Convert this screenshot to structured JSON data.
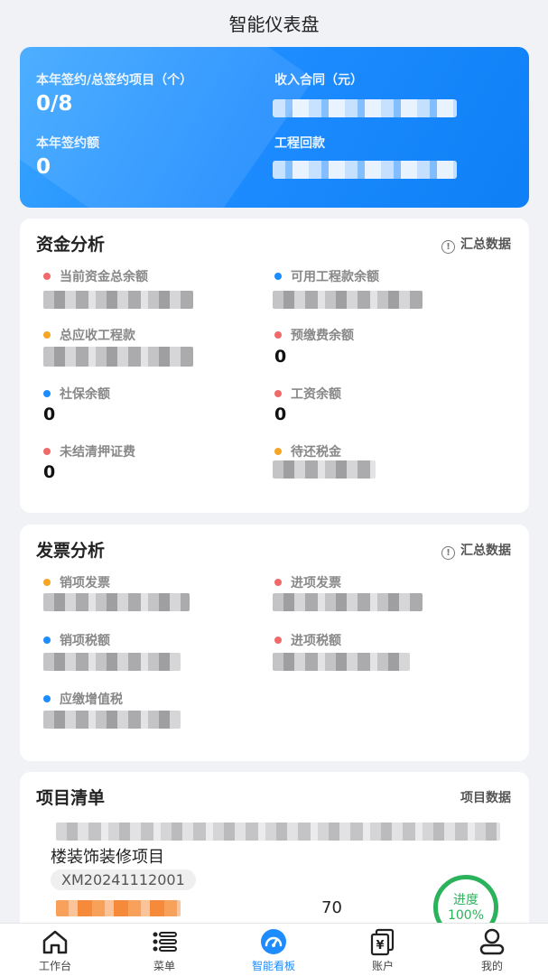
{
  "header": {
    "title": "智能仪表盘"
  },
  "summary": {
    "signed_projects_label": "本年签约/总签约项目（个）",
    "signed_projects_value": "0/8",
    "income_contract_label": "收入合同（元）",
    "signed_amount_label": "本年签约额",
    "signed_amount_value": "0",
    "project_return_label": "工程回款"
  },
  "funds": {
    "title": "资金分析",
    "link": "汇总数据",
    "items": [
      {
        "label": "当前资金总余额",
        "dot_color": "#f06a6a",
        "value": ""
      },
      {
        "label": "可用工程款余额",
        "dot_color": "#1d8cff",
        "value": ""
      },
      {
        "label": "总应收工程款",
        "dot_color": "#f5a623",
        "value": ""
      },
      {
        "label": "预缴费余额",
        "dot_color": "#f06a6a",
        "value": "0"
      },
      {
        "label": "社保余额",
        "dot_color": "#1d8cff",
        "value": "0"
      },
      {
        "label": "工资余额",
        "dot_color": "#f06a6a",
        "value": "0"
      },
      {
        "label": "未结清押证费",
        "dot_color": "#f06a6a",
        "value": "0"
      },
      {
        "label": "待还税金",
        "dot_color": "#f5a623",
        "value": ""
      }
    ]
  },
  "invoice": {
    "title": "发票分析",
    "link": "汇总数据",
    "items": [
      {
        "label": "销项发票",
        "dot_color": "#f5a623"
      },
      {
        "label": "进项发票",
        "dot_color": "#f06a6a"
      },
      {
        "label": "销项税额",
        "dot_color": "#1d8cff"
      },
      {
        "label": "进项税额",
        "dot_color": "#f06a6a"
      },
      {
        "label": "应缴增值税",
        "dot_color": "#1d8cff"
      }
    ]
  },
  "projects": {
    "title": "项目清单",
    "link": "项目数据",
    "item": {
      "name": "楼装饰装修项目",
      "code": "XM20241112001",
      "count": "70",
      "progress_label": "进度",
      "progress_value": "100%"
    }
  },
  "tabbar": {
    "items": [
      {
        "label": "工作台",
        "icon": "home-icon"
      },
      {
        "label": "菜单",
        "icon": "menu-list-icon"
      },
      {
        "label": "智能看板",
        "icon": "dashboard-gauge-icon"
      },
      {
        "label": "账户",
        "icon": "account-yen-icon"
      },
      {
        "label": "我的",
        "icon": "user-icon"
      }
    ],
    "active_index": 2,
    "active_color": "#1d8cff"
  }
}
